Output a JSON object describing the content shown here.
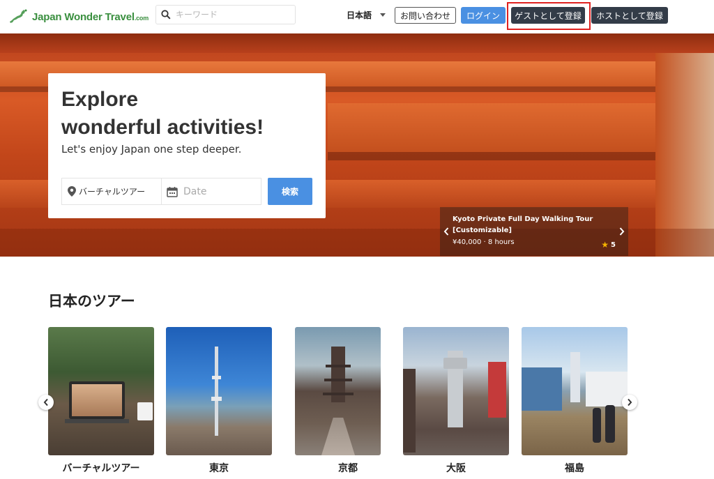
{
  "header": {
    "logo_text": "Japan Wonder Travel",
    "logo_suffix": ".com",
    "search_placeholder": "キーワード",
    "language": "日本語",
    "contact_label": "お問い合わせ",
    "login_label": "ログイン",
    "register_guest_label": "ゲストとして登録",
    "register_host_label": "ホストとして登録"
  },
  "hero": {
    "title_line1": "Explore",
    "title_line2": "wonderful activities!",
    "subtitle": "Let's enjoy Japan one step deeper.",
    "place_value": "バーチャルツアー",
    "date_placeholder": "Date",
    "search_button": "検索"
  },
  "featured": {
    "title": "Kyoto Private Full Day Walking Tour [Customizable]",
    "price": "¥40,000",
    "duration": "8 hours",
    "meta_separator": "·",
    "rating": "5"
  },
  "section": {
    "title": "日本のツアー",
    "destinations": [
      {
        "label": "バーチャルツアー"
      },
      {
        "label": "東京"
      },
      {
        "label": "京都"
      },
      {
        "label": "大阪"
      },
      {
        "label": "福島"
      }
    ]
  },
  "colors": {
    "brand_green": "#3a8f3f",
    "accent_blue": "#4a90e2",
    "dark_button": "#333c48",
    "highlight_red": "#e0211f",
    "star": "#f5b400"
  },
  "icons": {
    "search": "search-icon",
    "place": "map-pin-icon",
    "date": "calendar-icon",
    "rating": "star-icon"
  }
}
